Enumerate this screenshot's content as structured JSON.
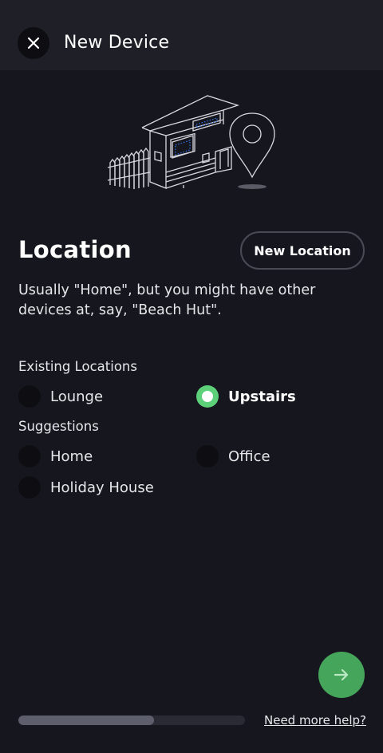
{
  "header": {
    "title": "New Device",
    "close_icon": "close-icon"
  },
  "illustration": {
    "icon": "house-with-location-pin-illustration"
  },
  "section": {
    "title": "Location",
    "new_location_label": "New Location",
    "description": "Usually \"Home\", but you might have other devices at, say, \"Beach Hut\"."
  },
  "existing": {
    "label": "Existing Locations",
    "options": [
      {
        "label": "Lounge",
        "selected": false
      },
      {
        "label": "Upstairs",
        "selected": true
      }
    ]
  },
  "suggestions": {
    "label": "Suggestions",
    "options": [
      {
        "label": "Home",
        "selected": false
      },
      {
        "label": "Office",
        "selected": false
      },
      {
        "label": "Holiday House",
        "selected": false
      }
    ]
  },
  "footer": {
    "next_icon": "arrow-right-icon",
    "progress": 0.6,
    "help_label": "Need more help?"
  },
  "colors": {
    "background": "#16161e",
    "header": "#1f1f28",
    "accent_green": "#5dd07a",
    "next_button": "#45a55b"
  }
}
